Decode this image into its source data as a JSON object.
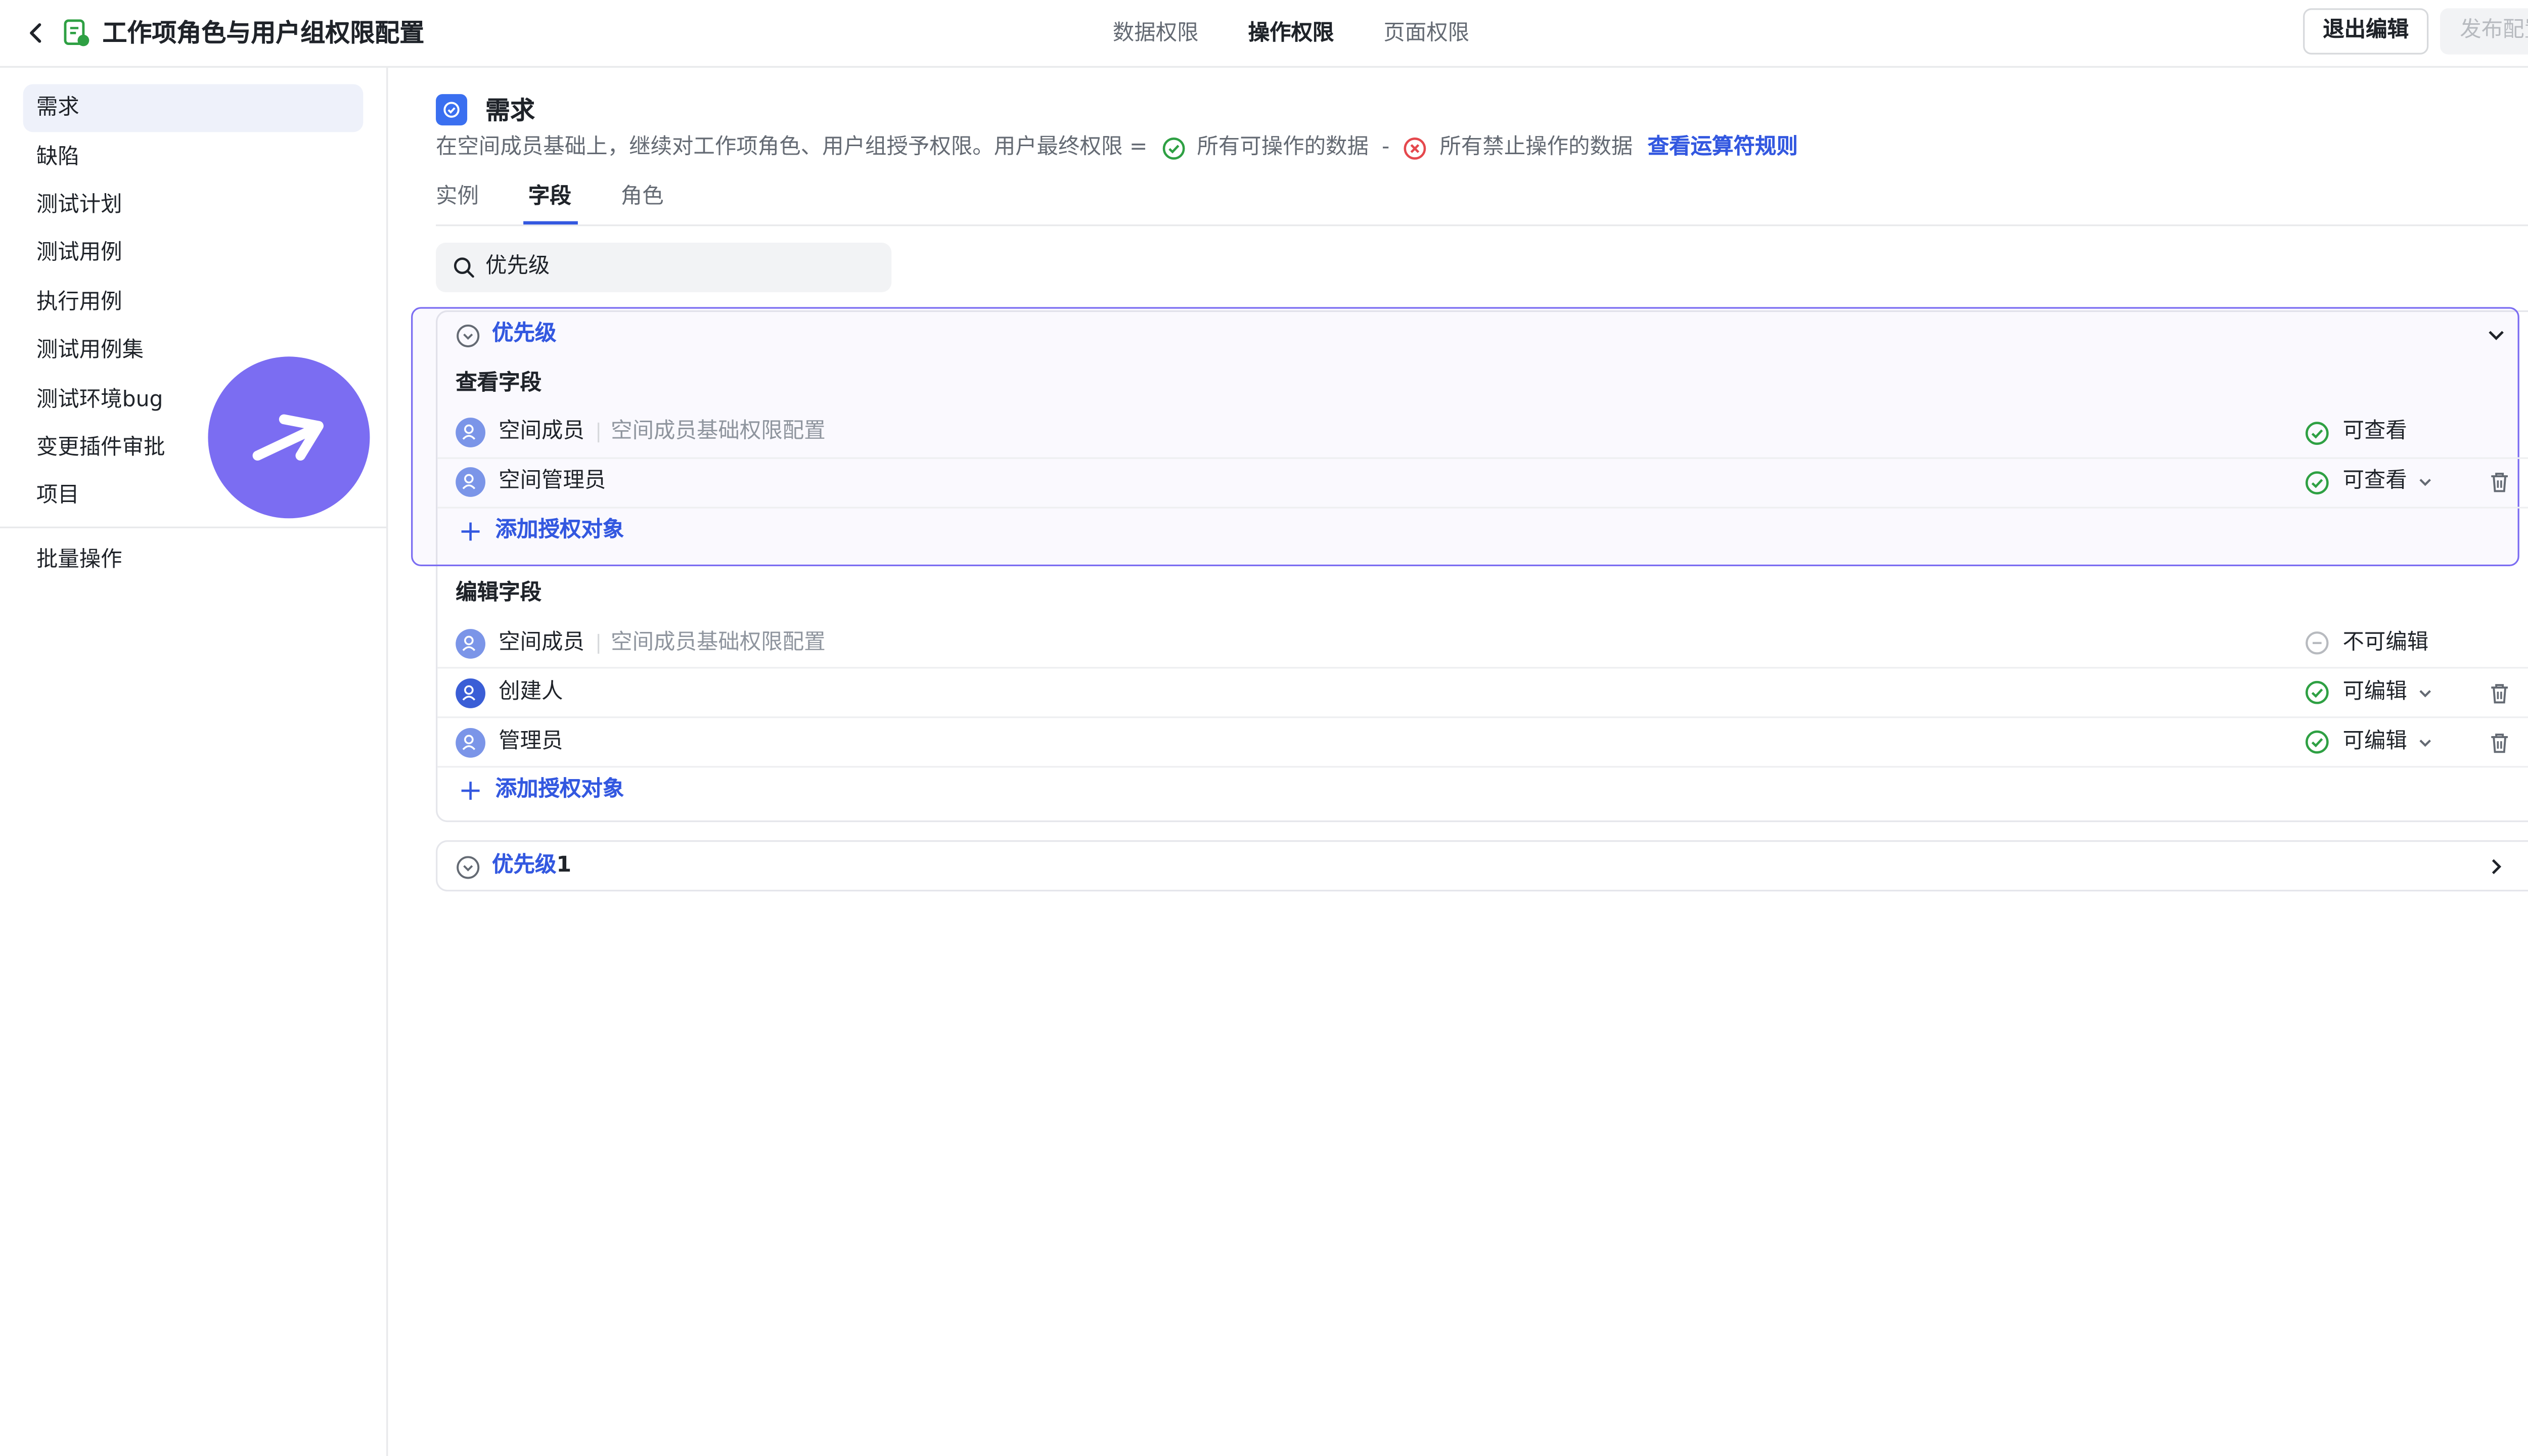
{
  "header": {
    "title": "工作项角色与用户组权限配置",
    "tabs": [
      {
        "label": "数据权限",
        "active": false
      },
      {
        "label": "操作权限",
        "active": true
      },
      {
        "label": "页面权限",
        "active": false
      }
    ],
    "exit_edit_label": "退出编辑",
    "publish_label": "发布配置"
  },
  "sidebar": {
    "items": [
      {
        "label": "需求",
        "active": true
      },
      {
        "label": "缺陷"
      },
      {
        "label": "测试计划"
      },
      {
        "label": "测试用例"
      },
      {
        "label": "执行用例"
      },
      {
        "label": "测试用例集"
      },
      {
        "label": "测试环境bug"
      },
      {
        "label": "变更插件审批"
      },
      {
        "label": "项目"
      }
    ],
    "batch_label": "批量操作"
  },
  "main": {
    "section_title": "需求",
    "description": {
      "prefix": "在空间成员基础上，继续对工作项角色、用户组授予权限。用户最终权限 =",
      "allowed": "所有可操作的数据",
      "minus": "-",
      "forbidden": "所有禁止操作的数据",
      "link": "查看运算符规则"
    },
    "sub_tabs": [
      {
        "label": "实例",
        "active": false
      },
      {
        "label": "字段",
        "active": true
      },
      {
        "label": "角色",
        "active": false
      }
    ],
    "search": {
      "value": "优先级",
      "placeholder": ""
    },
    "field_groups": [
      {
        "title": "优先级",
        "expanded": true,
        "view_section": {
          "heading": "查看字段",
          "rows": [
            {
              "name": "空间成员",
              "note": "空间成员基础权限配置",
              "status": "可查看",
              "status_type": "allowed"
            },
            {
              "name": "空间管理员",
              "note": "",
              "status": "可查看",
              "status_type": "allowed"
            }
          ],
          "add_label": "添加授权对象"
        },
        "edit_section": {
          "heading": "编辑字段",
          "rows": [
            {
              "name": "空间成员",
              "note": "空间成员基础权限配置",
              "status": "不可编辑",
              "status_type": "denied"
            },
            {
              "name": "创建人",
              "note": "",
              "status": "可编辑",
              "status_type": "allowed"
            },
            {
              "name": "管理员",
              "note": "",
              "status": "可编辑",
              "status_type": "allowed"
            }
          ],
          "add_label": "添加授权对象"
        }
      },
      {
        "title": "优先级",
        "title_suffix": "1",
        "expanded": false
      }
    ]
  },
  "colors": {
    "accent": "#3358e0",
    "highlight": "#7b6df2",
    "allowed": "#2ea043",
    "forbidden": "#e5484d"
  },
  "icons": [
    "back-arrow-icon",
    "document-icon",
    "check-circle-icon",
    "x-circle-icon",
    "search-icon",
    "user-group-icon",
    "plus-icon",
    "trash-icon",
    "chevron-down-icon",
    "chevron-right-icon",
    "help-icon"
  ]
}
